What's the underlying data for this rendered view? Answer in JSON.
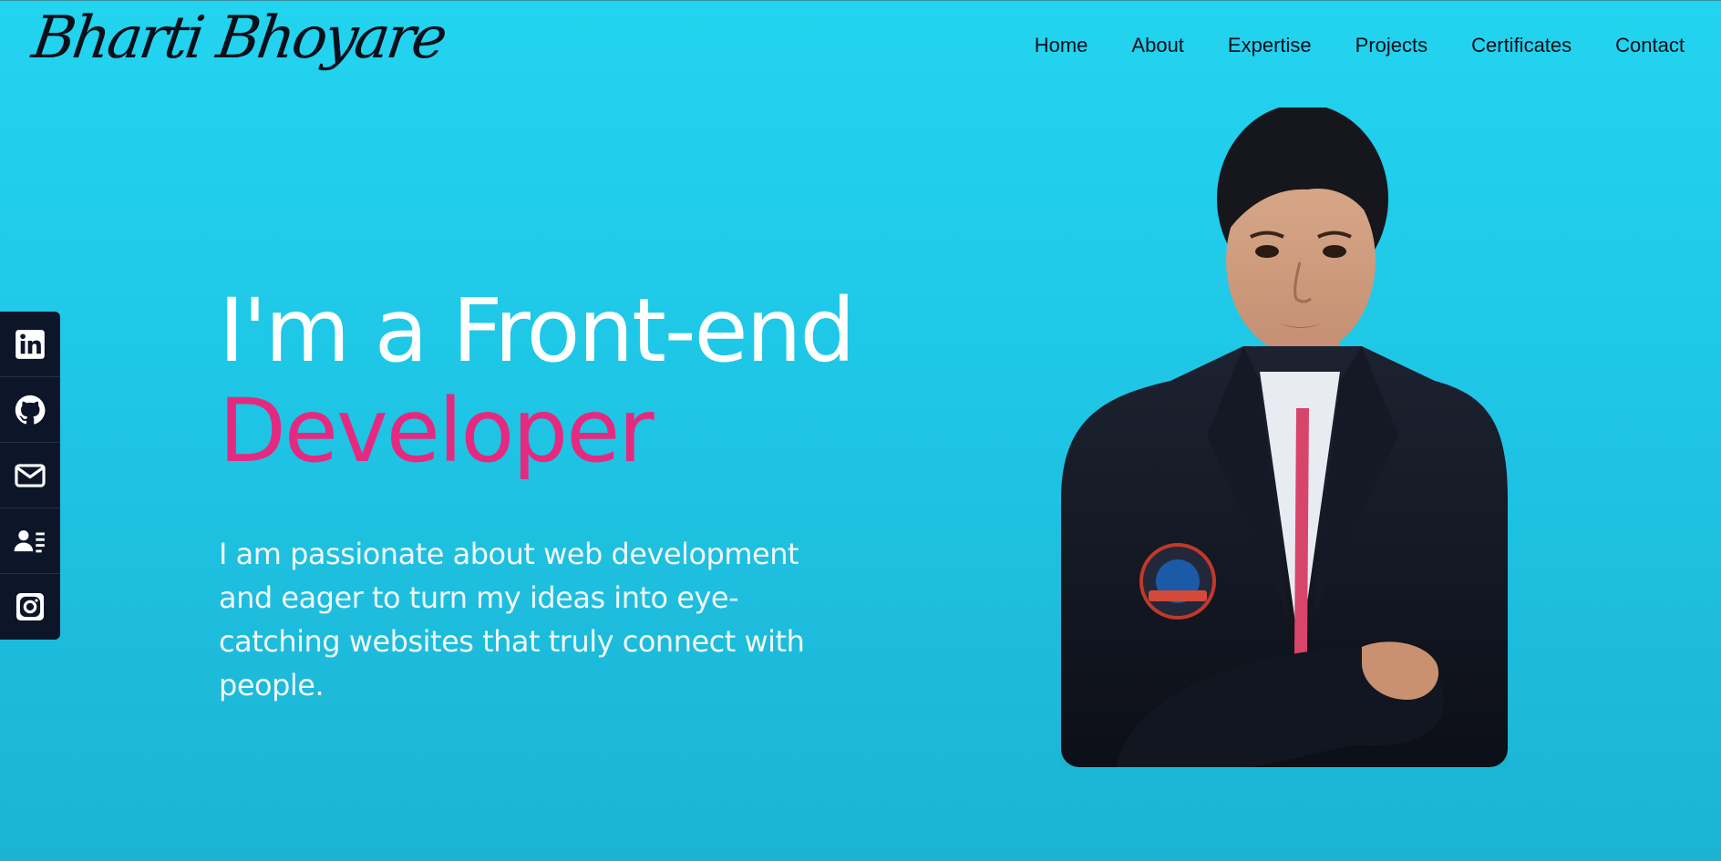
{
  "brand": {
    "name": "Bharti Bhoyare"
  },
  "nav": {
    "items": [
      "Home",
      "About",
      "Expertise",
      "Projects",
      "Certificates",
      "Contact"
    ]
  },
  "social": {
    "icons": [
      "linkedin-icon",
      "github-icon",
      "mail-icon",
      "resume-icon",
      "instagram-icon"
    ]
  },
  "hero": {
    "title_line1": "I'm a Front-end",
    "title_line2": "Developer",
    "description": "I am passionate about web development and eager to turn my ideas into eye-catching websites that truly connect with people."
  },
  "colors": {
    "background_top": "#22d4ef",
    "background_bottom": "#1cb3d3",
    "accent": "#e42a80",
    "dark": "#0d1628",
    "text_light": "#ffffff"
  }
}
